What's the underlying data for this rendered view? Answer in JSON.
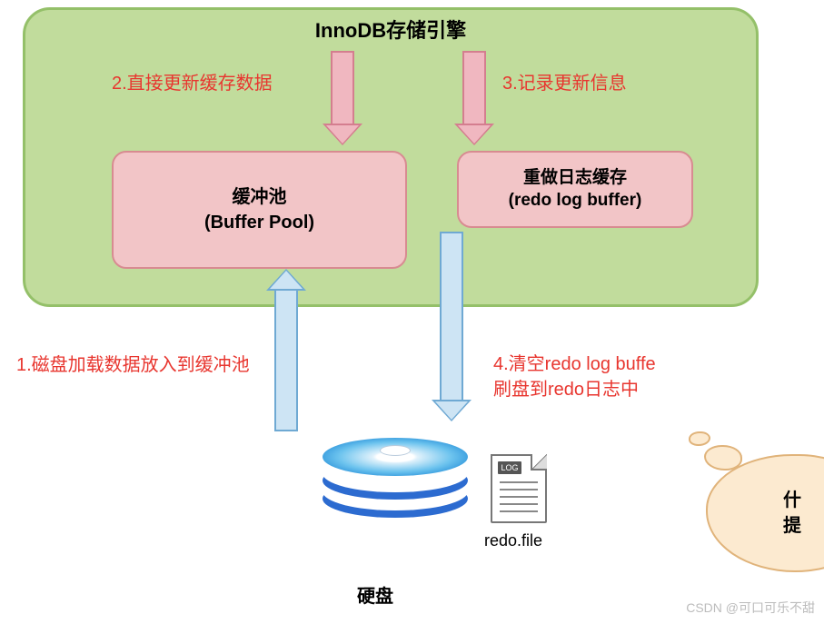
{
  "engine": {
    "title": "InnoDB存储引擎",
    "buffer_pool": {
      "line1": "缓冲池",
      "line2": "(Buffer Pool)"
    },
    "redo_buffer": {
      "line1": "重做日志缓存",
      "line2": "(redo log buffer)"
    }
  },
  "labels": {
    "step1": "1.磁盘加载数据放入到缓冲池",
    "step2": "2.直接更新缓存数据",
    "step3": "3.记录更新信息",
    "step4_line1": "4.清空redo log buffe",
    "step4_line2": "刷盘到redo日志中"
  },
  "disk": {
    "label": "硬盘",
    "file_tag": "LOG",
    "file_name": "redo.file"
  },
  "thought": {
    "line1": "什",
    "line2": "提"
  },
  "watermark": "CSDN @可口可乐不甜"
}
